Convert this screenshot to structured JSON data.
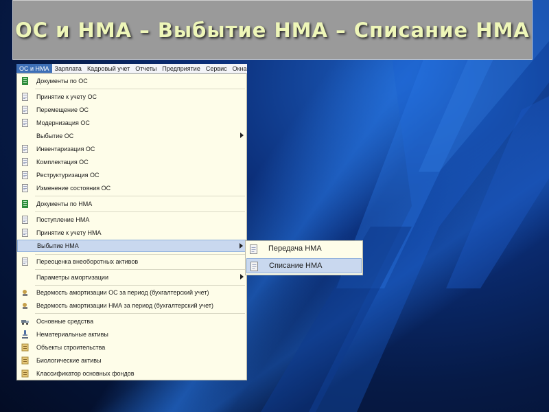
{
  "slide": {
    "title": "ОС и НМА – Выбытие НМА – Списание НМА"
  },
  "menubar": {
    "items": [
      {
        "label": "ОС и НМА"
      },
      {
        "label": "Зарплата"
      },
      {
        "label": "Кадровый учет"
      },
      {
        "label": "Отчеты"
      },
      {
        "label": "Предприятие"
      },
      {
        "label": "Сервис"
      },
      {
        "label": "Окна"
      }
    ]
  },
  "menu": {
    "items": [
      {
        "label": "Документы по ОС",
        "icon": "journal-green-icon"
      },
      {
        "label": "Принятие к учету ОС",
        "icon": "document-icon"
      },
      {
        "label": "Перемещение ОС",
        "icon": "document-icon"
      },
      {
        "label": "Модернизация ОС",
        "icon": "document-icon"
      },
      {
        "label": "Выбытие ОС",
        "icon": "none",
        "submenu": true
      },
      {
        "label": "Инвентаризация ОС",
        "icon": "document-icon"
      },
      {
        "label": "Комплектация ОС",
        "icon": "document-icon"
      },
      {
        "label": "Реструктуризация ОС",
        "icon": "document-icon"
      },
      {
        "label": "Изменение состояния ОС",
        "icon": "document-icon"
      },
      {
        "label": "Документы по НМА",
        "icon": "journal-green-icon"
      },
      {
        "label": "Поступление НМА",
        "icon": "document-icon"
      },
      {
        "label": "Принятие к учету НМА",
        "icon": "document-icon"
      },
      {
        "label": "Выбытие НМА",
        "icon": "none",
        "submenu": true,
        "selected": true
      },
      {
        "label": "Переоценка внеоборотных активов",
        "icon": "document-icon"
      },
      {
        "label": "Параметры амортизации",
        "icon": "none",
        "submenu": true
      },
      {
        "label": "Ведомость амортизации ОС за период (бухгалтерский учет)",
        "icon": "report-icon"
      },
      {
        "label": "Ведомость амортизации НМА за период (бухгалтерский учет)",
        "icon": "report-icon"
      },
      {
        "label": "Основные средства",
        "icon": "truck-icon"
      },
      {
        "label": "Нематериальные активы",
        "icon": "microscope-icon"
      },
      {
        "label": "Объекты строительства",
        "icon": "catalog-icon"
      },
      {
        "label": "Биологические активы",
        "icon": "catalog-icon"
      },
      {
        "label": "Классификатор основных фондов",
        "icon": "catalog-icon"
      }
    ]
  },
  "submenu": {
    "items": [
      {
        "label": "Передача НМА",
        "icon": "document-icon"
      },
      {
        "label": "Списание НМА",
        "icon": "document-icon",
        "selected": true
      }
    ]
  },
  "colors": {
    "title_bg": "#9a9a9a",
    "title_text": "#eef6b8",
    "menu_bg": "#fefde9",
    "selection": "#c9d8ef",
    "menubar_active": "#3d6fb6"
  }
}
